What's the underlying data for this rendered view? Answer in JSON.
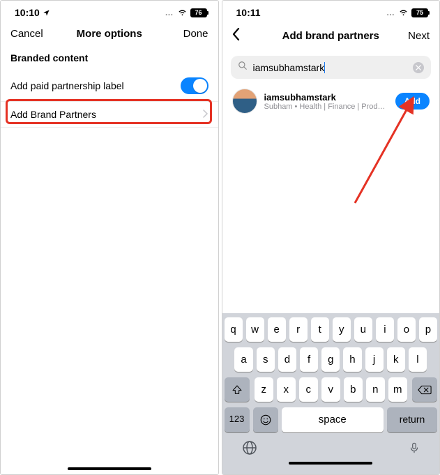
{
  "left": {
    "status": {
      "time": "10:10",
      "battery": "76"
    },
    "nav": {
      "left": "Cancel",
      "title": "More options",
      "right": "Done"
    },
    "section_header": "Branded content",
    "paid_label_row": "Add paid partnership label",
    "add_partners_row": "Add Brand Partners"
  },
  "right": {
    "status": {
      "time": "10:11",
      "battery": "75"
    },
    "nav": {
      "title": "Add brand partners",
      "right": "Next"
    },
    "search": {
      "value": "iamsubhamstark"
    },
    "result": {
      "name": "iamsubhamstark",
      "subtitle": "Subham • Health | Finance | Productivity",
      "button": "Add"
    },
    "keyboard": {
      "row1": [
        "q",
        "w",
        "e",
        "r",
        "t",
        "y",
        "u",
        "i",
        "o",
        "p"
      ],
      "row2": [
        "a",
        "s",
        "d",
        "f",
        "g",
        "h",
        "j",
        "k",
        "l"
      ],
      "row3": [
        "z",
        "x",
        "c",
        "v",
        "b",
        "n",
        "m"
      ],
      "numkey": "123",
      "space": "space",
      "return": "return"
    }
  }
}
